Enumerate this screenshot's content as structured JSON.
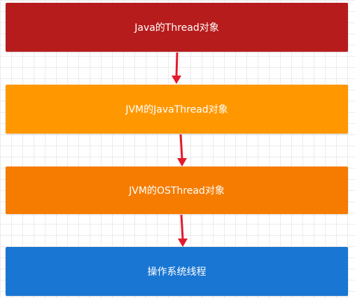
{
  "diagram": {
    "nodes": [
      {
        "label": "Java的Thread对象",
        "color": "#b71c1c"
      },
      {
        "label": "JVM的JavaThread对象",
        "color": "#ff9800"
      },
      {
        "label": "JVM的OSThread对象",
        "color": "#f57c00"
      },
      {
        "label": "操作系统线程",
        "color": "#1976d2"
      }
    ],
    "arrow_color": "#e21b2e"
  }
}
